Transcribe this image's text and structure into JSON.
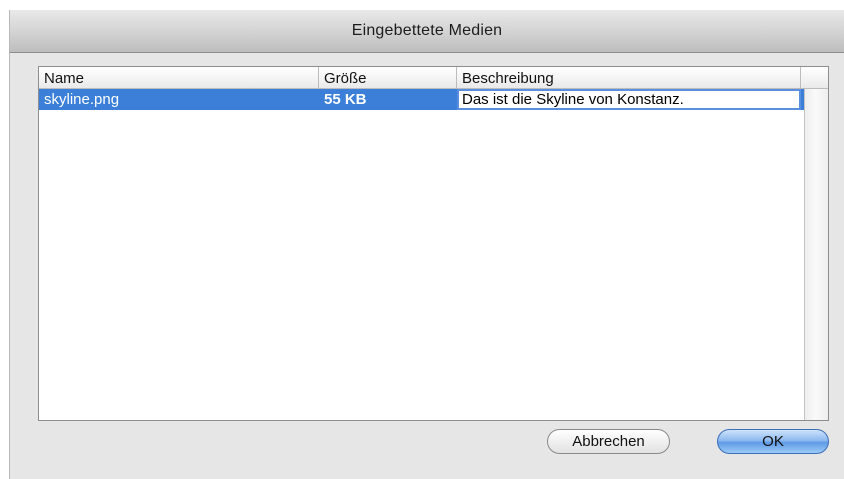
{
  "window": {
    "title": "Eingebettete Medien"
  },
  "table": {
    "columns": [
      "Name",
      "Größe",
      "Beschreibung"
    ],
    "rows": [
      {
        "name": "skyline.png",
        "size": "55 KB",
        "description": "Das ist die Skyline von Konstanz."
      }
    ]
  },
  "buttons": {
    "cancel": "Abbrechen",
    "ok": "OK"
  },
  "colors": {
    "selection": "#3b7fd9",
    "window_bg": "#e6e6e6",
    "ok_accent": "#5f9ae6"
  }
}
